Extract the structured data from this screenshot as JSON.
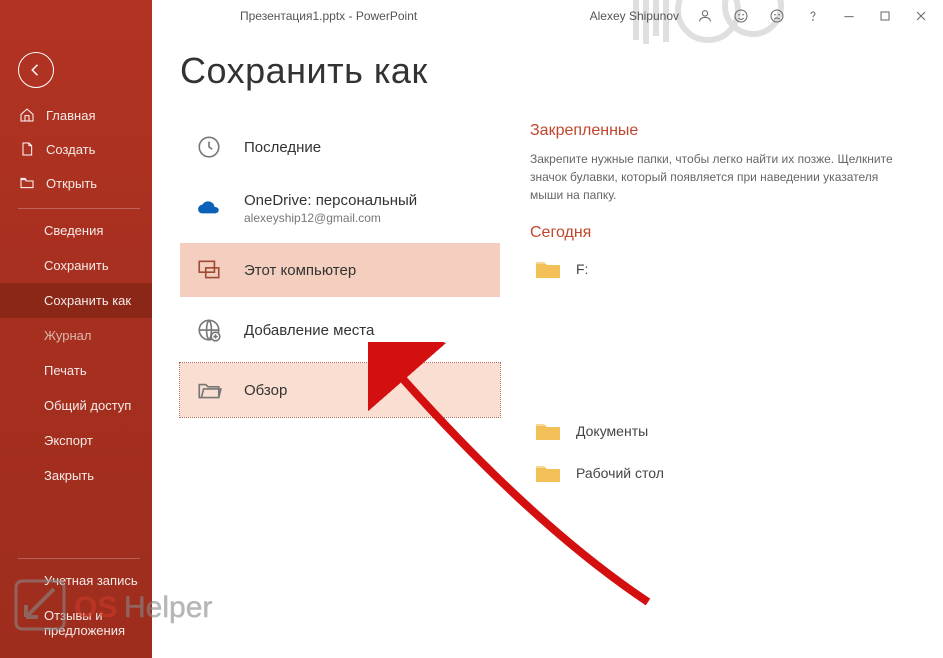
{
  "titlebar": {
    "title": "Презентация1.pptx  -  PowerPoint",
    "username": "Alexey Shipunov"
  },
  "sidebar": {
    "top": [
      {
        "icon": "home-icon",
        "label": "Главная"
      },
      {
        "icon": "new-icon",
        "label": "Создать"
      },
      {
        "icon": "open-icon",
        "label": "Открыть"
      }
    ],
    "menu": [
      {
        "label": "Сведения"
      },
      {
        "label": "Сохранить"
      },
      {
        "label": "Сохранить как",
        "active": true
      },
      {
        "label": "Журнал",
        "dim": true
      },
      {
        "label": "Печать"
      },
      {
        "label": "Общий доступ"
      },
      {
        "label": "Экспорт"
      },
      {
        "label": "Закрыть"
      }
    ],
    "bottom": [
      {
        "label": "Учетная запись"
      },
      {
        "label": "Отзывы и предложения"
      }
    ]
  },
  "main": {
    "title": "Сохранить как",
    "locations": {
      "recent": "Последние",
      "onedrive_title": "OneDrive: персональный",
      "onedrive_sub": "alexeyship12@gmail.com",
      "thispc": "Этот компьютер",
      "addplace": "Добавление места",
      "browse": "Обзор"
    },
    "right": {
      "pinned_title": "Закрепленные",
      "pinned_desc": "Закрепите нужные папки, чтобы легко найти их позже. Щелкните значок булавки, который появляется при наведении указателя мыши на папку.",
      "today_title": "Сегодня",
      "folders": [
        {
          "label": "F:"
        },
        {
          "label": "Документы"
        },
        {
          "label": "Рабочий стол"
        }
      ]
    }
  }
}
